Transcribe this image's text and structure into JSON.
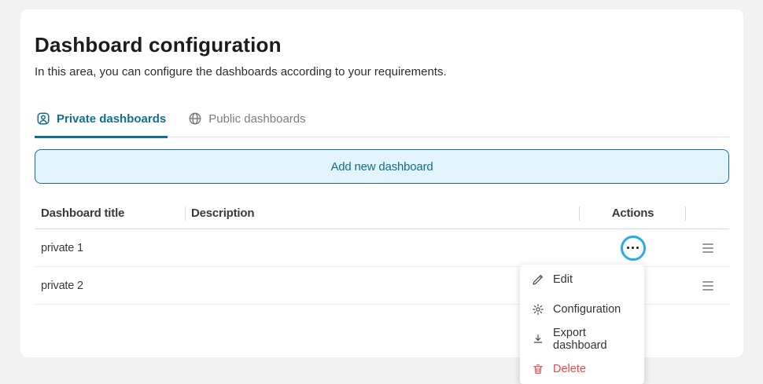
{
  "page": {
    "title": "Dashboard configuration",
    "subtitle": "In this area, you can configure the dashboards according to your requirements."
  },
  "tabs": [
    {
      "label": "Private dashboards",
      "icon": "user-badge-icon",
      "active": true
    },
    {
      "label": "Public dashboards",
      "icon": "globe-icon",
      "active": false
    }
  ],
  "add_button": {
    "label": "Add new dashboard"
  },
  "table": {
    "columns": [
      "Dashboard title",
      "Description",
      "Actions"
    ],
    "rows": [
      {
        "title": "private 1",
        "description": ""
      },
      {
        "title": "private 2",
        "description": ""
      }
    ]
  },
  "actions_menu": {
    "items": [
      {
        "label": "Edit",
        "icon": "pencil-icon"
      },
      {
        "label": "Configuration",
        "icon": "gear-icon"
      },
      {
        "label": "Export dashboard",
        "icon": "download-icon"
      },
      {
        "label": "Delete",
        "icon": "trash-icon",
        "danger": true
      }
    ]
  },
  "colors": {
    "accent_teal": "#136f90",
    "button_bg": "#e2f3fb",
    "focus_ring": "#2aabe3",
    "danger": "#e5484d",
    "inactive_tab": "#7d7d7d"
  }
}
